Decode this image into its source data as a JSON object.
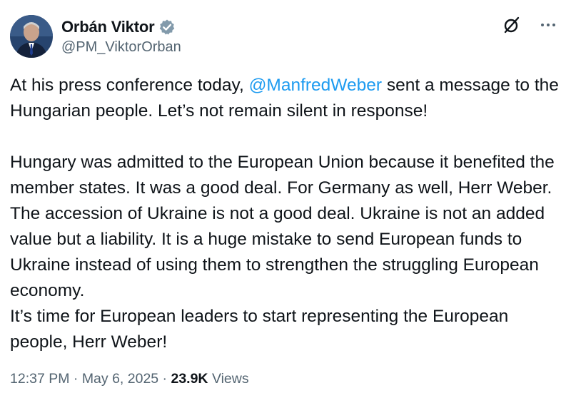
{
  "author": {
    "display_name": "Orbán Viktor",
    "handle": "@PM_ViktorOrban",
    "verified_icon": "verified-badge-icon",
    "avatar_icon": "avatar"
  },
  "actions": {
    "grok_icon": "grok-icon",
    "more_icon": "more-dots-icon"
  },
  "tweet": {
    "p1_before": "At his press conference today, ",
    "p1_mention": "@ManfredWeber",
    "p1_after": " sent a message to the Hungarian people. Let’s not remain silent in response!",
    "p2": "Hungary was admitted to the European Union because it benefited the member states. It was a good deal. For Germany as well, Herr Weber. The accession of Ukraine is not a good deal. Ukraine is not an added value but a liability. It is a huge mistake to send European funds to Ukraine instead of using them to strengthen the struggling European economy.",
    "p3": "It’s time for European leaders to start representing the European people, Herr Weber!"
  },
  "meta": {
    "time": "12:37 PM",
    "sep1": " · ",
    "date": "May 6, 2025",
    "sep2": " · ",
    "views_count": "23.9K",
    "views_label": " Views"
  },
  "colors": {
    "mention": "#1d9bf0",
    "secondary_text": "#536471",
    "verified": "#829aab"
  }
}
